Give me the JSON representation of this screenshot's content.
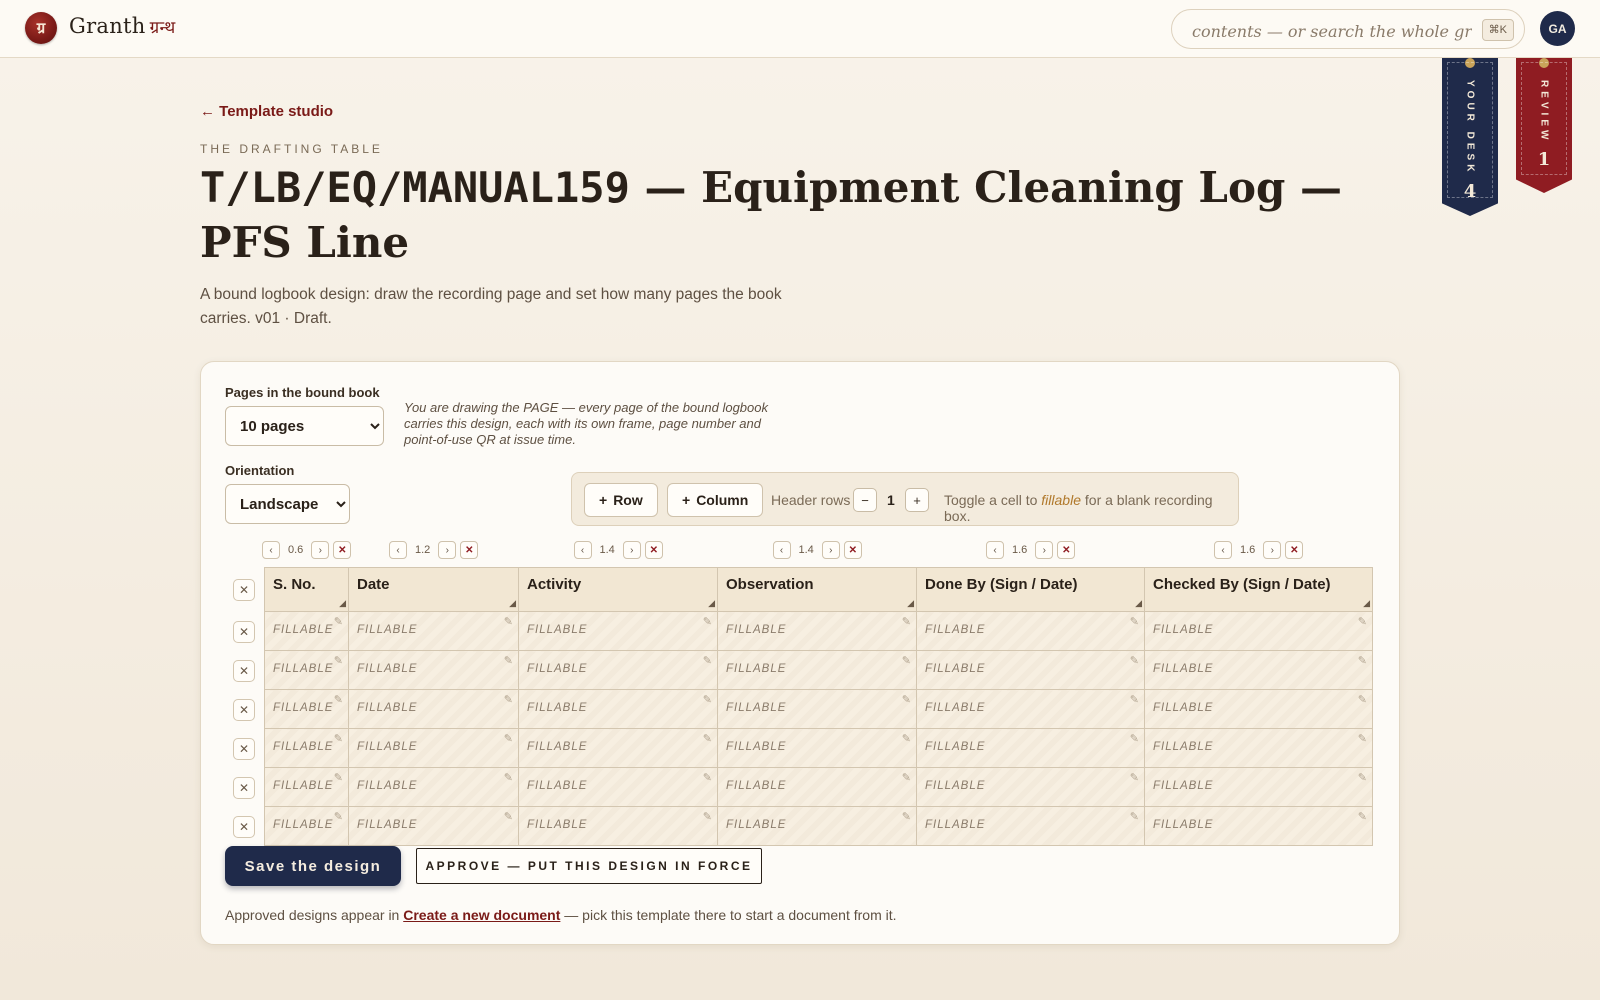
{
  "topbar": {
    "logo_glyph": "ग्र",
    "brand": "Granth",
    "brand_devanagari": "ग्रन्थ",
    "search_placeholder": "contents — or search the whole granth...",
    "search_shortcut": "⌘K",
    "avatar": "GA"
  },
  "ribbons": {
    "desk": {
      "label": "YOUR DESK",
      "count": "4"
    },
    "review": {
      "label": "REVIEW",
      "count": "1"
    }
  },
  "header": {
    "back_link": "← Template studio",
    "eyebrow": "THE DRAFTING TABLE",
    "title_code": "T/LB/EQ/MANUAL159",
    "title_rest": " — Equipment Cleaning Log — PFS Line",
    "subtitle": "A bound logbook design: draw the recording page and set how many pages the book carries. v01 · Draft."
  },
  "settings": {
    "pages_label": "Pages in the bound book",
    "pages_value": "10 pages",
    "orientation_label": "Orientation",
    "orientation_value": "Landscape",
    "note": "You are drawing the PAGE — every page of the bound logbook carries this design, each with its own frame, page number and point-of-use QR at issue time."
  },
  "toolbar": {
    "add_row": "Row",
    "add_column": "Column",
    "header_rows_label": "Header rows",
    "header_rows_value": "1",
    "hint_prefix": "Toggle a cell to ",
    "hint_em": "fillable",
    "hint_suffix": " for a blank recording box."
  },
  "grid": {
    "columns": [
      {
        "name": "S. No.",
        "width": "0.6"
      },
      {
        "name": "Date",
        "width": "1.2"
      },
      {
        "name": "Activity",
        "width": "1.4"
      },
      {
        "name": "Observation",
        "width": "1.4"
      },
      {
        "name": "Done By (Sign / Date)",
        "width": "1.6"
      },
      {
        "name": "Checked By (Sign / Date)",
        "width": "1.6"
      }
    ],
    "fillable_label": "FILLABLE",
    "row_count": 6
  },
  "actions": {
    "save": "Save the design",
    "approve": "APPROVE — PUT THIS DESIGN IN FORCE"
  },
  "footnote": {
    "prefix": "Approved designs appear in ",
    "link": "Create a new document",
    "suffix": " — pick this template there to start a document from it."
  },
  "colors": {
    "accent_red": "#7a1a17",
    "navy": "#1f2a4a",
    "review_red": "#8f1c22"
  }
}
